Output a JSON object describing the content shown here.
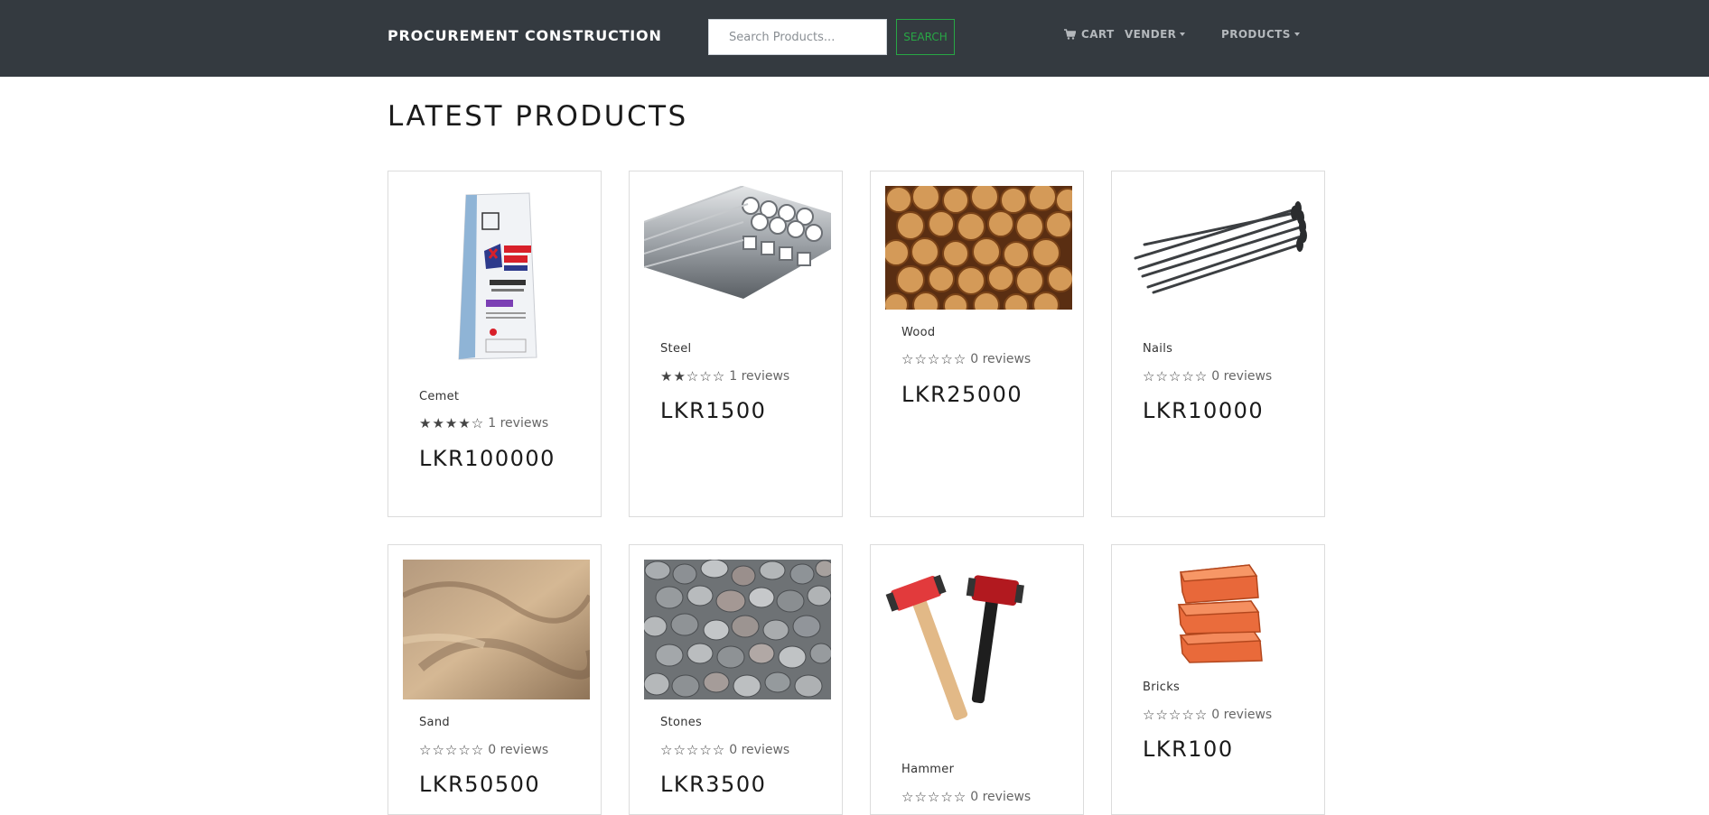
{
  "navbar": {
    "brand": "PROCUREMENT CONSTRUCTION",
    "search_placeholder": "Search Products...",
    "search_button": "SEARCH",
    "cart_label": "CART",
    "vender_label": "VENDER",
    "products_label": "PRODUCTS"
  },
  "main": {
    "title": "LATEST PRODUCTS"
  },
  "products": [
    {
      "name": "Cemet",
      "stars": "★★★★☆",
      "rating": 4,
      "reviews": "1 reviews",
      "price": "LKR100000"
    },
    {
      "name": "Steel",
      "stars": "★★☆☆☆",
      "rating": 2,
      "reviews": "1 reviews",
      "price": "LKR1500"
    },
    {
      "name": "Wood",
      "stars": "☆☆☆☆☆",
      "rating": 0,
      "reviews": "0 reviews",
      "price": "LKR25000"
    },
    {
      "name": "Nails",
      "stars": "☆☆☆☆☆",
      "rating": 0,
      "reviews": "0 reviews",
      "price": "LKR10000"
    },
    {
      "name": "Sand",
      "stars": "☆☆☆☆☆",
      "rating": 0,
      "reviews": "0 reviews",
      "price": "LKR50500"
    },
    {
      "name": "Stones",
      "stars": "☆☆☆☆☆",
      "rating": 0,
      "reviews": "0 reviews",
      "price": "LKR3500"
    },
    {
      "name": "Hammer",
      "stars": "☆☆☆☆☆",
      "rating": 0,
      "reviews": "0 reviews",
      "price": ""
    },
    {
      "name": "Bricks",
      "stars": "☆☆☆☆☆",
      "rating": 0,
      "reviews": "0 reviews",
      "price": "LKR100"
    }
  ],
  "colors": {
    "navbar_bg": "#343a40",
    "search_accent": "#28a745"
  }
}
